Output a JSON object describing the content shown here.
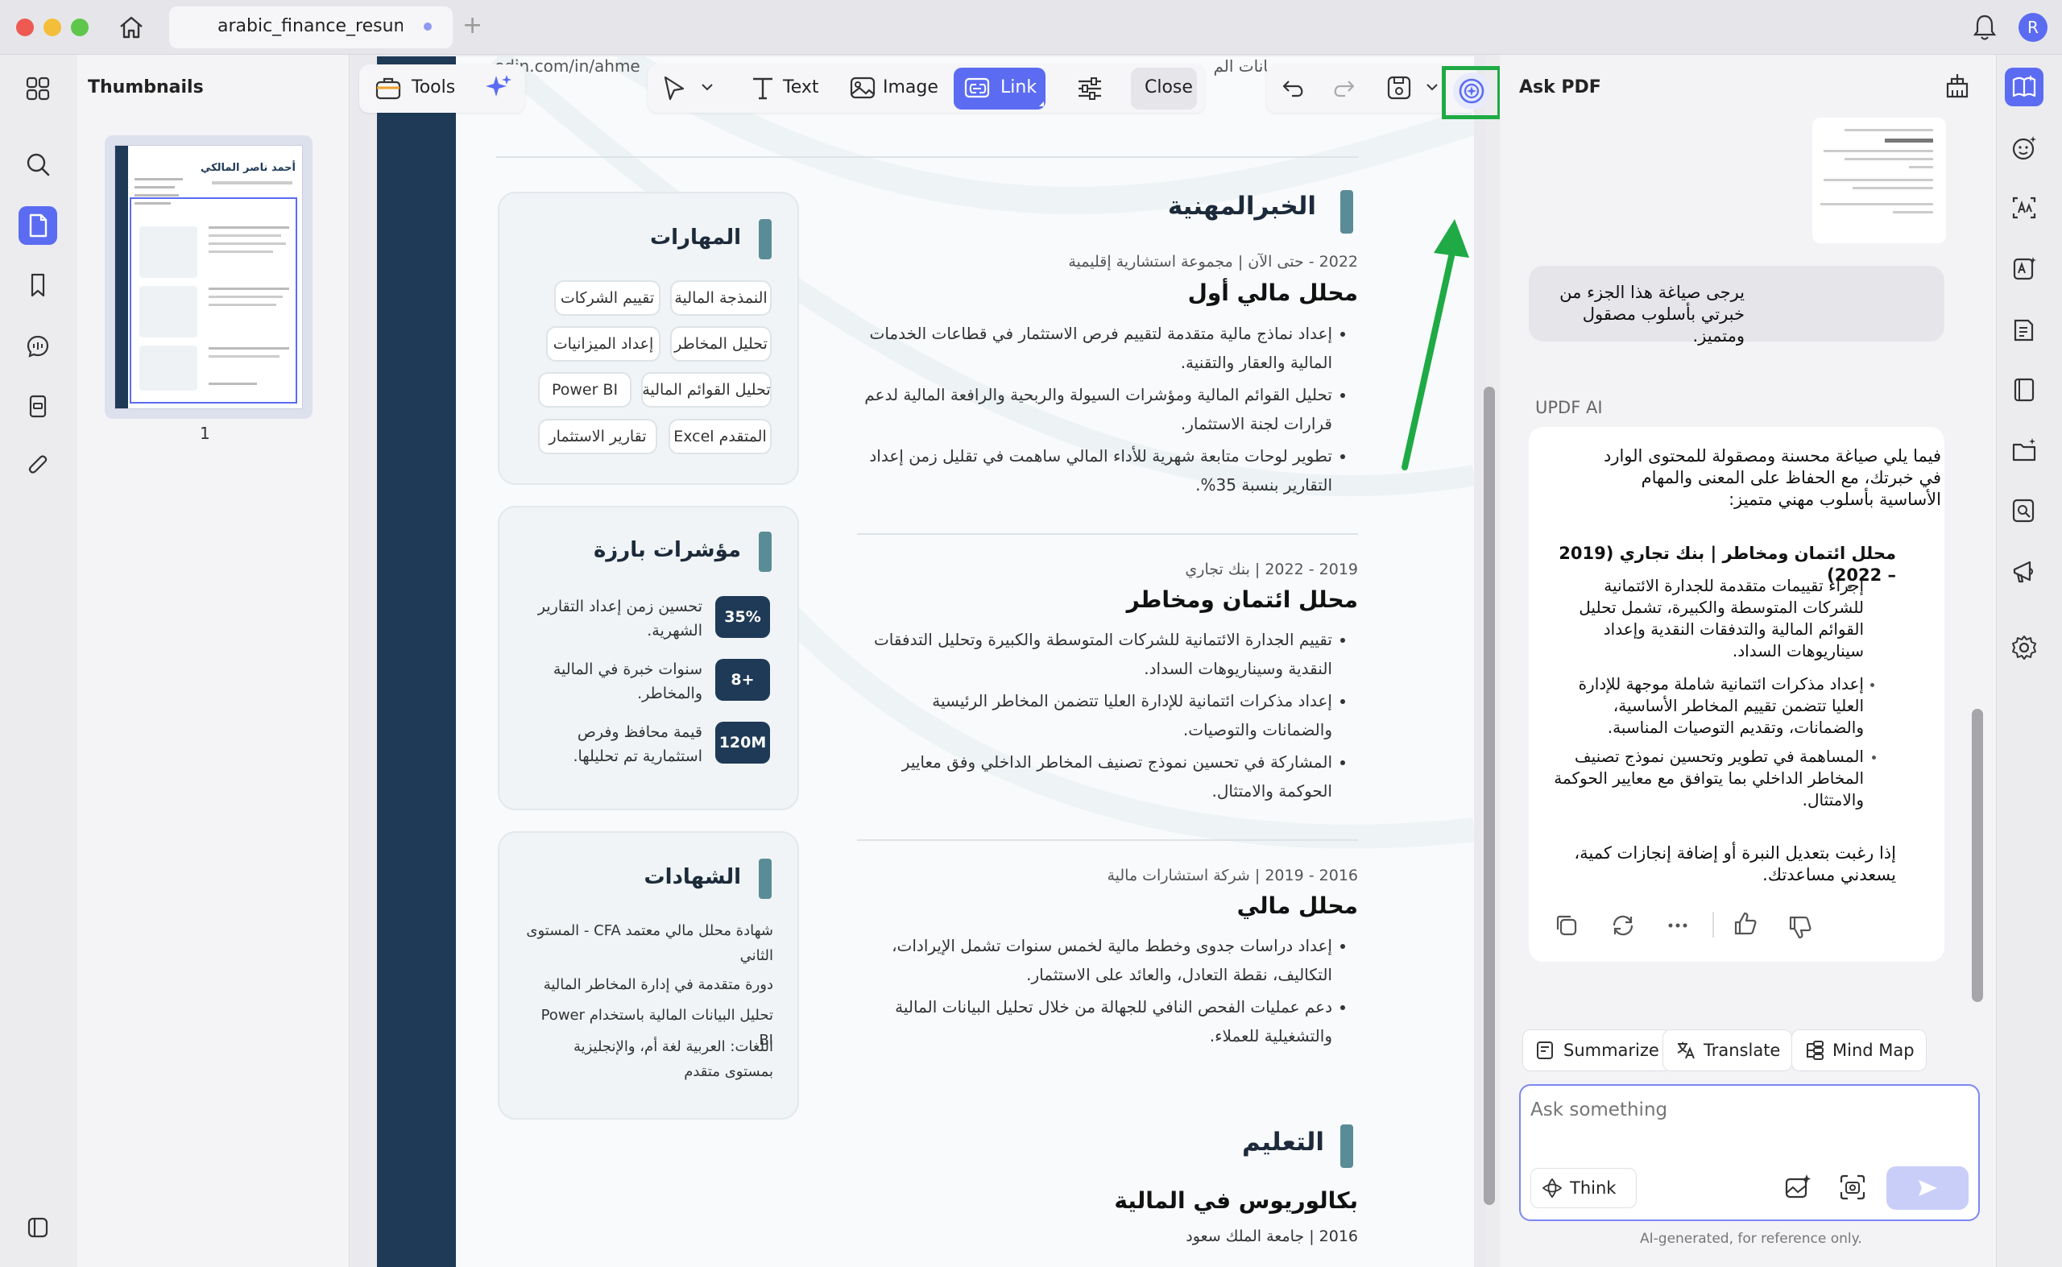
{
  "window": {
    "tab_title": "arabic_finance_resume",
    "new_tab_symbol": "+",
    "avatar_initial": "R"
  },
  "thumbnails": {
    "title": "Thumbnails",
    "page_number": "1",
    "mini_name": "أحمد ناصر المالكي"
  },
  "toolbar": {
    "tools_label": "Tools",
    "text_label": "Text",
    "image_label": "Image",
    "link_label": "Link",
    "close_label": "Close"
  },
  "doc": {
    "header_fragment_url": "edin.com/in/ahme",
    "header_fragment_ar": "بيانات الم",
    "experience_title": "الخبرالمهنية",
    "jobs": [
      {
        "meta": "2022 - حتى الآن | مجموعة استشارية إقليمية",
        "title": "محلل مالي أول",
        "bullets": [
          "إعداد نماذج مالية متقدمة لتقييم فرص الاستثمار في قطاعات الخدمات المالية والعقار والتقنية.",
          "تحليل القوائم المالية ومؤشرات السيولة والربحية والرافعة المالية لدعم قرارات لجنة الاستثمار.",
          "تطوير لوحات متابعة شهرية للأداء المالي ساهمت في تقليل زمن إعداد التقارير بنسبة 35%."
        ]
      },
      {
        "meta": "2019 - 2022 | بنك تجاري",
        "title": "محلل ائتمان ومخاطر",
        "bullets": [
          "تقييم الجدارة الائتمانية للشركات المتوسطة والكبيرة وتحليل التدفقات النقدية وسيناريوهات السداد.",
          "إعداد مذكرات ائتمانية للإدارة العليا تتضمن المخاطر الرئيسية والضمانات والتوصيات.",
          "المشاركة في تحسين نموذج تصنيف المخاطر الداخلي وفق معايير الحوكمة والامتثال."
        ]
      },
      {
        "meta": "2016 - 2019 | شركة استشارات مالية",
        "title": "محلل مالي",
        "bullets": [
          "إعداد دراسات جدوى وخطط مالية لخمس سنوات تشمل الإيرادات، التكاليف، نقطة التعادل، والعائد على الاستثمار.",
          "دعم عمليات الفحص النافي للجهالة من خلال تحليل البيانات المالية والتشغيلية للعملاء."
        ]
      }
    ],
    "education_title": "التعليم",
    "degree": "بكالوريوس في المالية",
    "school": "2016 | جامعة الملك سعود",
    "skills_title": "المهارات",
    "skills": [
      "النمذجة المالية",
      "تقييم الشركات",
      "تحليل المخاطر",
      "إعداد الميزانيات",
      "تحليل القوائم المالية",
      "Power BI",
      "Excel المتقدم",
      "تقارير الاستثمار"
    ],
    "highlights_title": "مؤشرات بارزة",
    "highlights": [
      {
        "value": "35%",
        "text": "تحسين زمن إعداد التقارير الشهرية."
      },
      {
        "value": "8+",
        "text": "سنوات خبرة في المالية والمخاطر."
      },
      {
        "value": "120M",
        "text": "قيمة محافظ وفرص استثمارية تم تحليلها."
      }
    ],
    "certs_title": "الشهادات",
    "certs": [
      "شهادة محلل مالي معتمد CFA - المستوى الثاني",
      "دورة متقدمة في إدارة المخاطر المالية",
      "تحليل البيانات المالية باستخدام Power BI",
      "اللغات: العربية لغة أم، والإنجليزية بمستوى متقدم"
    ]
  },
  "ask": {
    "title": "Ask PDF",
    "user_message": "يرجى صياغة هذا الجزء من خبرتي بأسلوب مصقول ومتميز.",
    "ai_label": "UPDF AI",
    "ai_intro": "فيما يلي صياغة محسنة ومصقولة للمحتوى الوارد في خبرتك، مع الحفاظ على المعنى والمهام الأساسية بأسلوب مهني متميز:",
    "ai_heading": "محلل ائتمان ومخاطر | بنك تجاري (2019 – 2022)",
    "ai_bullets": [
      "إجراء تقييمات متقدمة للجدارة الائتمانية للشركات المتوسطة والكبيرة، تشمل تحليل القوائم المالية والتدفقات النقدية وإعداد سيناريوهات السداد.",
      "إعداد مذكرات ائتمانية شاملة موجهة للإدارة العليا تتضمن تقييم المخاطر الأساسية، والضمانات، وتقديم التوصيات المناسبة.",
      "المساهمة في تطوير وتحسين نموذج تصنيف المخاطر الداخلي بما يتوافق مع معايير الحوكمة والامتثال."
    ],
    "ai_outro": "إذا رغبت بتعديل النبرة أو إضافة إنجازات كمية، يسعدني مساعدتك.",
    "summarize_label": "Summarize",
    "translate_label": "Translate",
    "mindmap_label": "Mind Map",
    "input_placeholder": "Ask something",
    "think_label": "Think",
    "disclaimer": "AI-generated, for reference only."
  },
  "colors": {
    "accent": "#5b6cf2",
    "highlight_box": "#1faa45",
    "annotation_arrow": "#1faa45",
    "resume_navy": "#1f3a56",
    "resume_teal": "#5a8c97"
  }
}
